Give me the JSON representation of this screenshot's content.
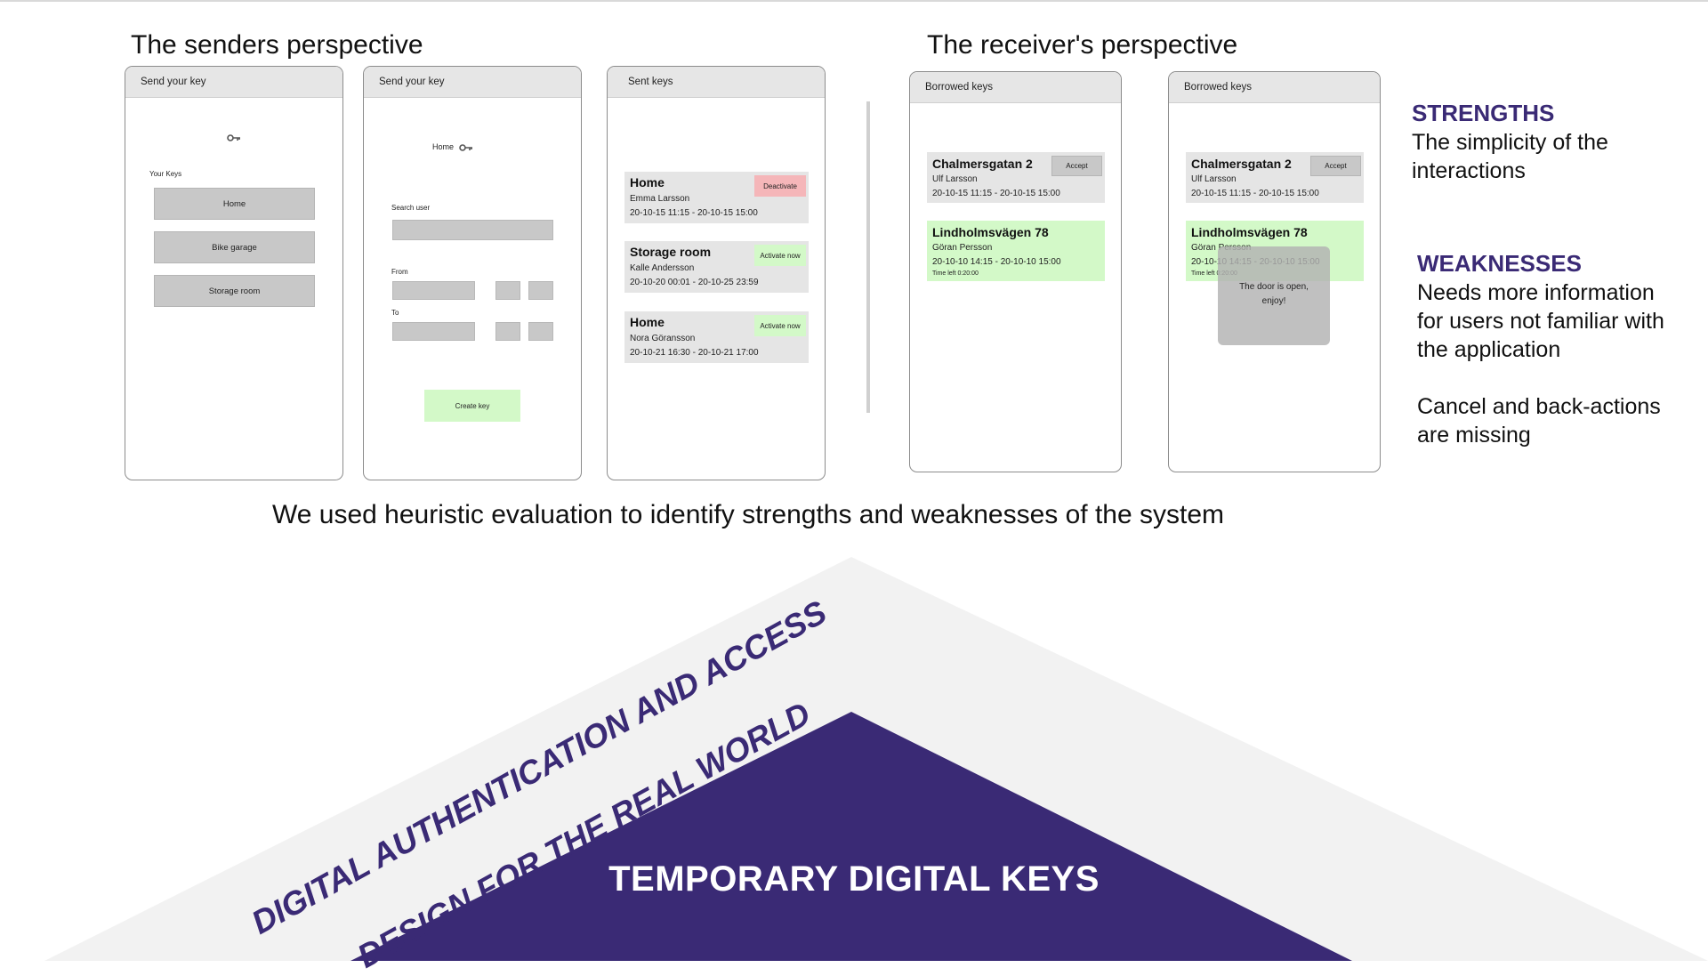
{
  "titles": {
    "senders": "The senders perspective",
    "receivers": "The receiver's perspective"
  },
  "screen1": {
    "header": "Send your key",
    "icon": "key-icon",
    "your_keys_label": "Your Keys",
    "keys": [
      "Home",
      "Bike garage",
      "Storage room"
    ]
  },
  "screen2": {
    "header": "Send your key",
    "selected_key": "Home",
    "icon": "key-icon",
    "search_label": "Search user",
    "from_label": "From",
    "to_label": "To",
    "create_button": "Create key"
  },
  "screen3": {
    "header": "Sent keys",
    "items": [
      {
        "title": "Home",
        "name": "Emma Larsson",
        "dates": "20-10-15 11:15 - 20-10-15 15:00",
        "action": "Deactivate",
        "action_color": "#f5b6b9"
      },
      {
        "title": "Storage room",
        "name": "Kalle Andersson",
        "dates": "20-10-20 00:01 - 20-10-25 23:59",
        "action": "Activate now",
        "action_color": "#d3f9c8"
      },
      {
        "title": "Home",
        "name": "Nora Göransson",
        "dates": "20-10-21 16:30 - 20-10-21 17:00",
        "action": "Activate now",
        "action_color": "#d3f9c8"
      }
    ]
  },
  "screen4": {
    "header": "Borrowed keys",
    "card1": {
      "title": "Chalmersgatan 2",
      "name": "Ulf Larsson",
      "dates": "20-10-15 11:15 - 20-10-15 15:00",
      "action": "Accept"
    },
    "card2": {
      "title": "Lindholmsvägen 78",
      "name": "Göran Persson",
      "dates": "20-10-10 14:15 - 20-10-10 15:00",
      "time_left": "Time left 0:20:00"
    }
  },
  "screen5": {
    "header": "Borrowed keys",
    "card1": {
      "title": "Chalmersgatan 2",
      "name": "Ulf Larsson",
      "dates": "20-10-15 11:15 - 20-10-15 15:00",
      "action": "Accept"
    },
    "card2": {
      "title": "Lindholmsvägen 78",
      "name": "Göran Persson",
      "dates": "20-10-10 14:15 - 20-10-10 15:00",
      "time_left": "Time left 0:20:00"
    },
    "toast": "The door is open, enjoy!"
  },
  "strengths": {
    "heading": "STRENGTHS",
    "text": "The simplicity of the interactions"
  },
  "weaknesses": {
    "heading": "WEAKNESSES",
    "text1": "Needs more information for users not familiar with the application",
    "text2": "Cancel and back-actions are missing"
  },
  "caption": "We used heuristic evaluation to identify strengths and weaknesses of the system",
  "pyramid": {
    "outer_label": "DIGITAL AUTHENTICATION AND ACCESS",
    "middle_label": "DESIGN FOR THE REAL WORLD",
    "center_label": "TEMPORARY DIGITAL KEYS",
    "outer_color": "#f2f2f2",
    "inner_color": "#3a2a75"
  }
}
